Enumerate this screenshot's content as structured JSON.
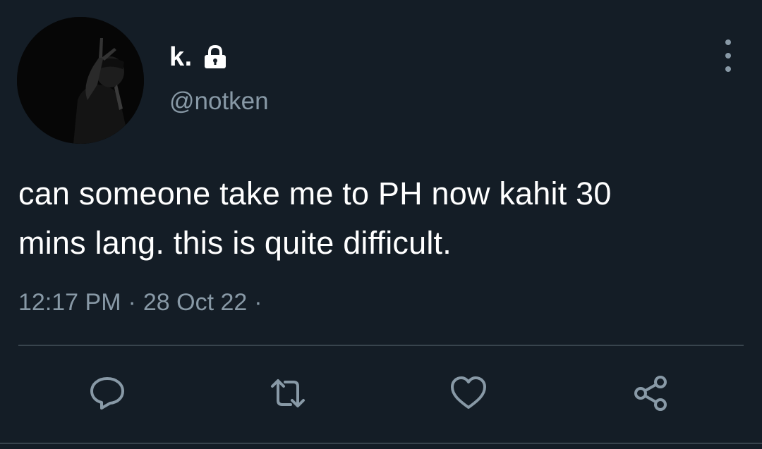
{
  "user": {
    "display_name": "k.",
    "handle": "@notken",
    "protected_icon": "lock-icon"
  },
  "tweet": {
    "text_line1": "can someone take me to PH now kahit 30",
    "text_line2": "mins lang. this is quite difficult.",
    "time": "12:17 PM",
    "separator": "·",
    "date": "28 Oct 22",
    "trailing_separator": "·"
  },
  "actions": {
    "reply_icon": "reply-icon",
    "retweet_icon": "retweet-icon",
    "like_icon": "heart-icon",
    "share_icon": "share-icon"
  },
  "colors": {
    "background": "#141d26",
    "primary_text": "#ffffff",
    "secondary_text": "#8899a6",
    "divider": "#38444d"
  }
}
